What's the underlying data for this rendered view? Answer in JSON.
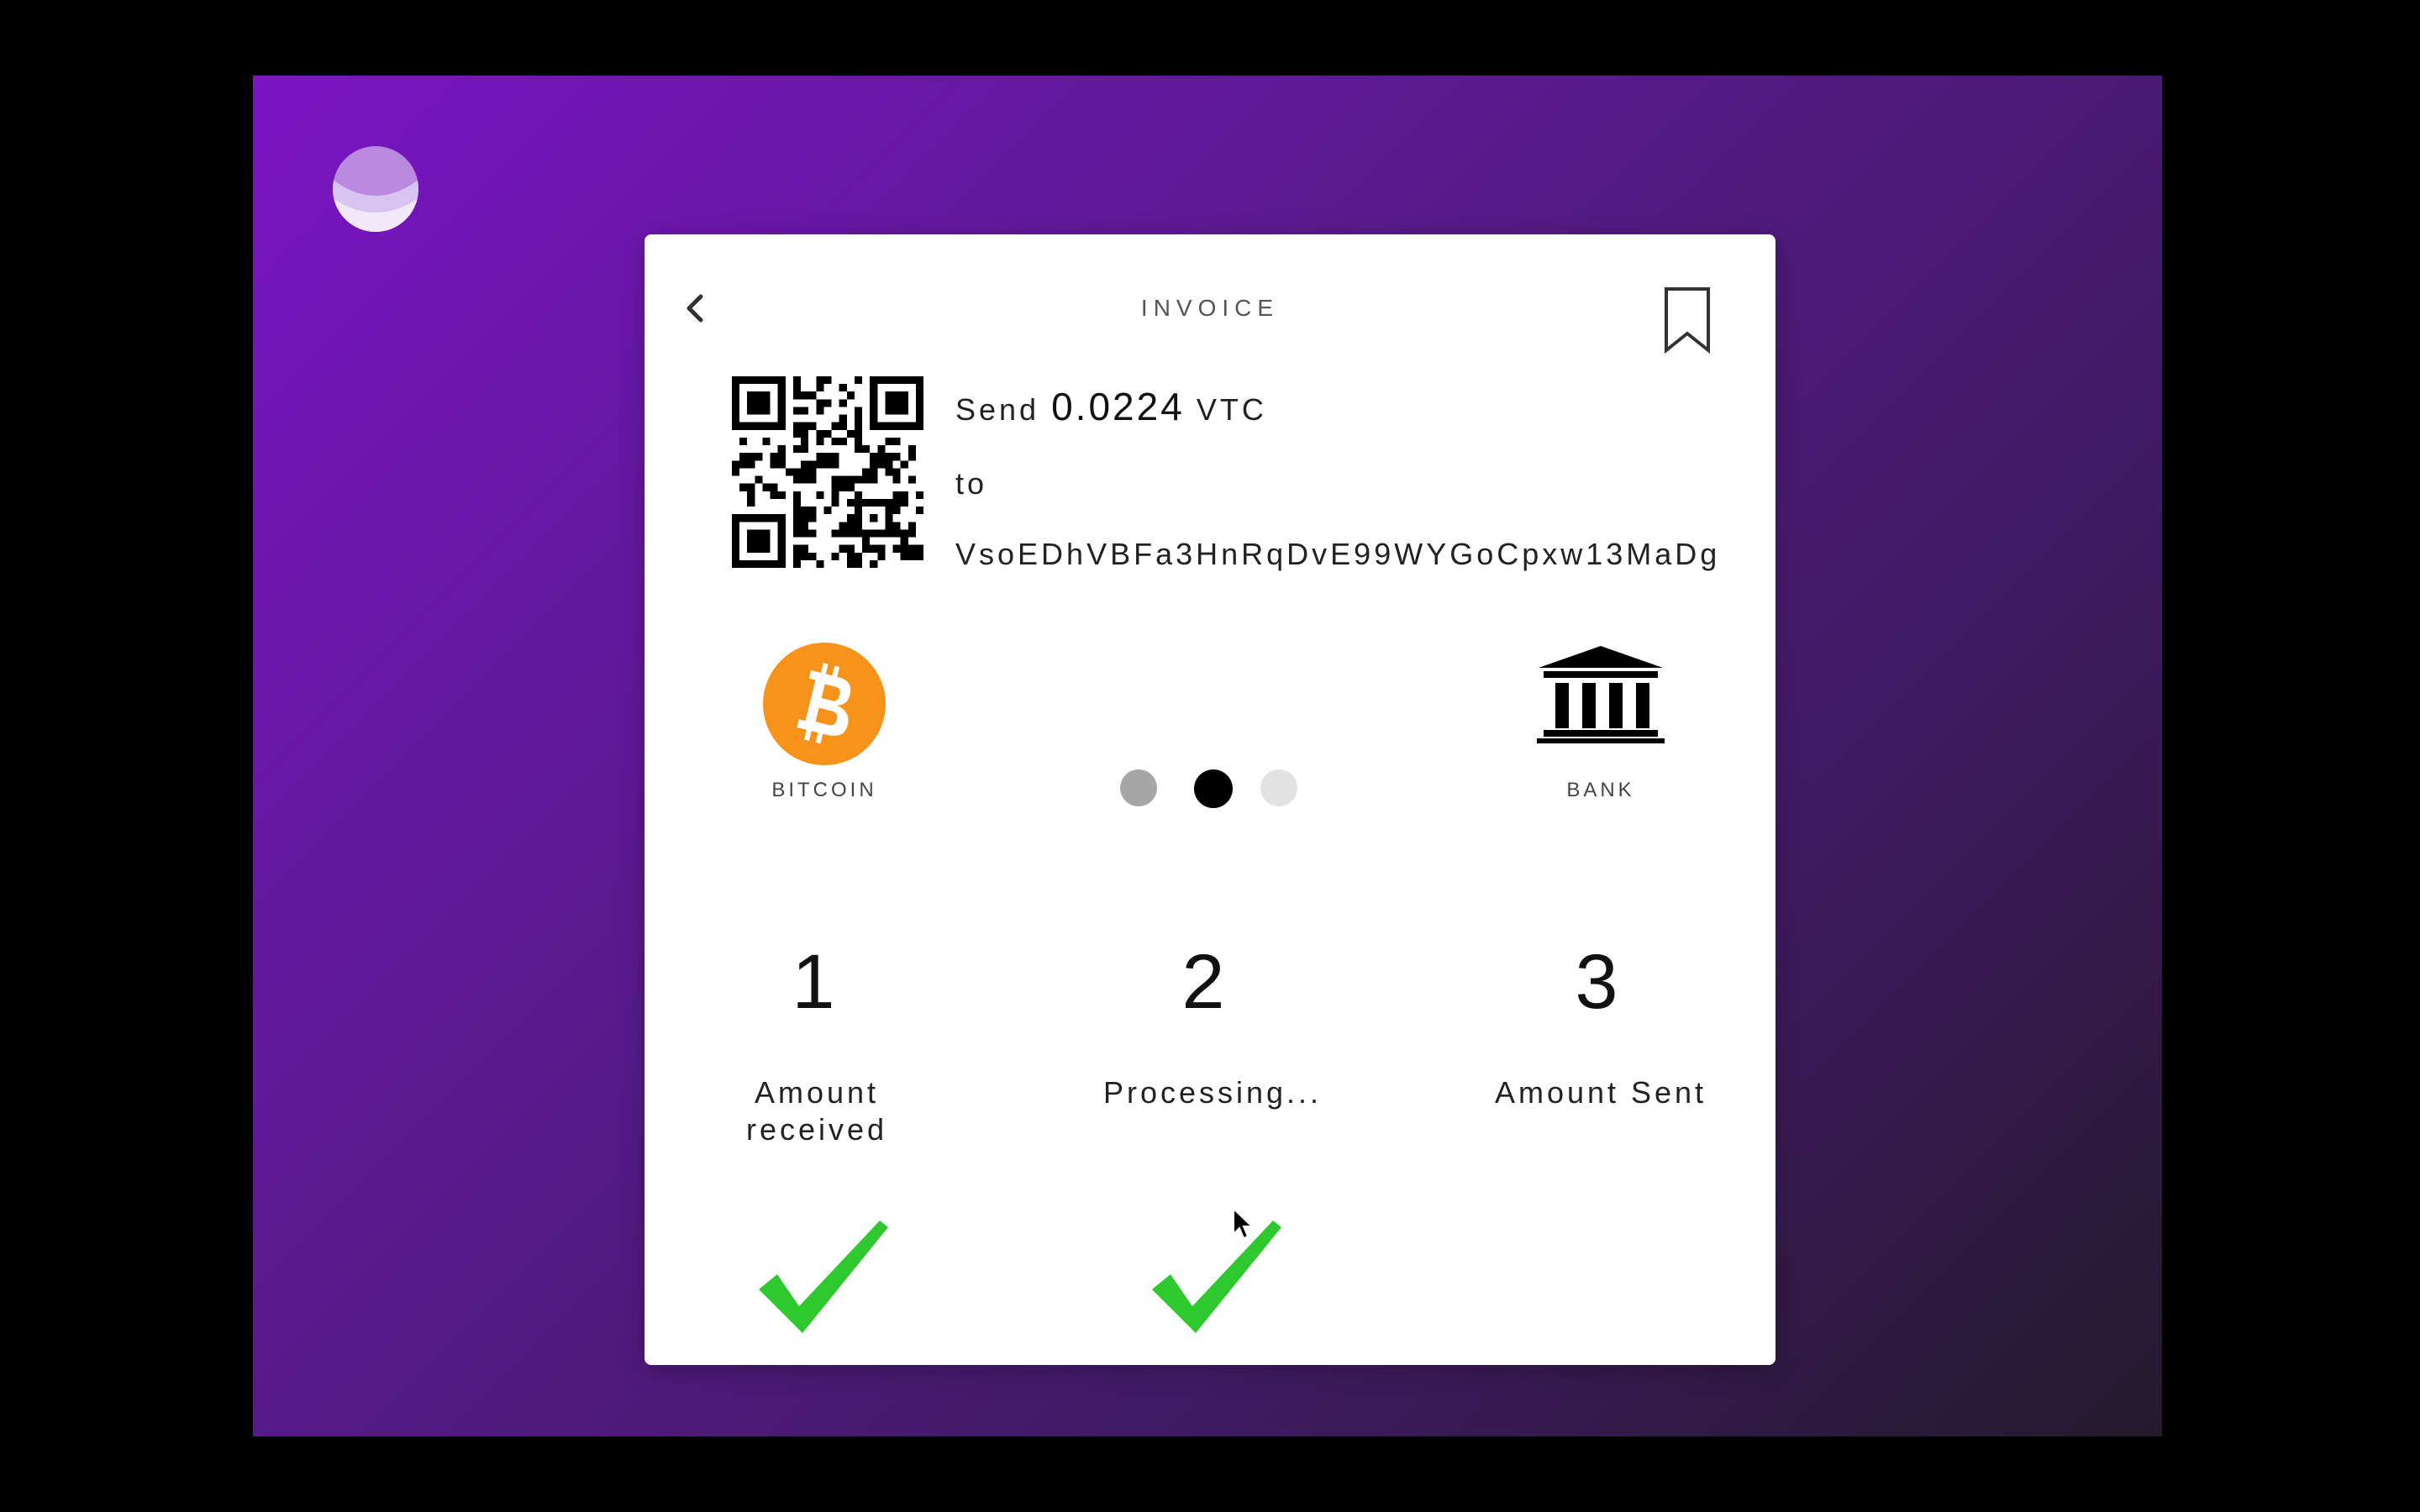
{
  "app": {
    "logo_icon": "app-logo-orb",
    "background_colors": [
      "#7a14c4",
      "#241a2c"
    ]
  },
  "invoice": {
    "back_icon": "chevron-left-icon",
    "title": "INVOICE",
    "bookmark_icon": "bookmark-icon",
    "qr_icon": "qr-code",
    "send_label": "Send",
    "amount": "0.0224",
    "currency": "VTC",
    "to_label": "to",
    "address": "VsoEDhVBFa3HnRqDvE99WYGoCpxw13MaDg"
  },
  "route": {
    "source": {
      "icon": "bitcoin-icon",
      "label": "BITCOIN",
      "color": "#f7931a"
    },
    "progress": {
      "total": 3,
      "active_index": 1,
      "colors": [
        "#a6a6a6",
        "#000000",
        "#e2e2e2"
      ]
    },
    "destination": {
      "icon": "bank-icon",
      "label": "BANK"
    }
  },
  "steps": [
    {
      "number": "1",
      "label_line1": "Amount",
      "label_line2": "received",
      "completed": true
    },
    {
      "number": "2",
      "label_line1": "Processing...",
      "label_line2": "",
      "completed": true
    },
    {
      "number": "3",
      "label_line1": "Amount Sent",
      "label_line2": "",
      "completed": false
    }
  ],
  "check_color": "#2fc92f"
}
